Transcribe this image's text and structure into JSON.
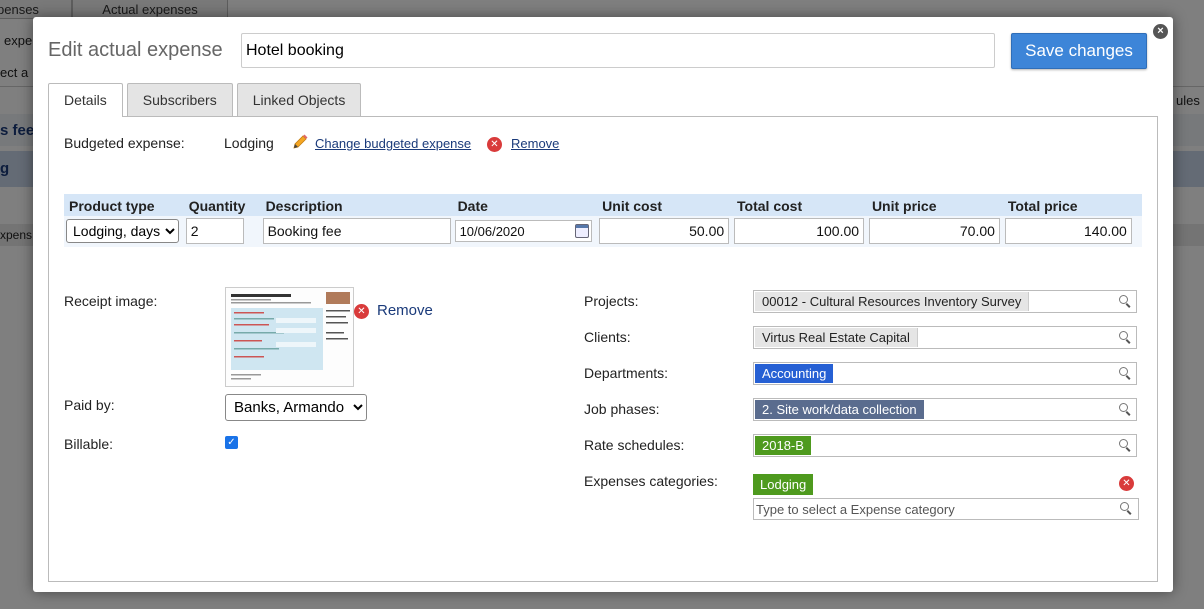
{
  "background": {
    "tabs": [
      "penses",
      "Actual expenses"
    ],
    "fragments": [
      "expe",
      "ect a",
      "ules",
      "s fee",
      "g",
      "xpens"
    ]
  },
  "modal": {
    "title": "Edit actual expense",
    "name_value": "Hotel booking",
    "save_label": "Save changes",
    "close_label": "×"
  },
  "tabs": [
    "Details",
    "Subscribers",
    "Linked Objects"
  ],
  "budgeted": {
    "label": "Budgeted expense:",
    "value": "Lodging",
    "change_link": "Change budgeted expense",
    "remove_link": "Remove"
  },
  "table": {
    "headers": [
      "Product type",
      "Quantity",
      "Description",
      "Date",
      "Unit cost",
      "Total cost",
      "Unit price",
      "Total price"
    ],
    "row": {
      "product_type": "Lodging, days",
      "quantity": "2",
      "description": "Booking fee",
      "date": "10/06/2020",
      "unit_cost": "50.00",
      "total_cost": "100.00",
      "unit_price": "70.00",
      "total_price": "140.00"
    }
  },
  "receipt": {
    "label": "Receipt image:",
    "remove_label": "Remove"
  },
  "paid_by": {
    "label": "Paid by:",
    "value": "Banks, Armando"
  },
  "billable": {
    "label": "Billable:",
    "checked": true
  },
  "fields": {
    "projects": {
      "label": "Projects:",
      "value": "00012 - Cultural Resources Inventory Survey"
    },
    "clients": {
      "label": "Clients:",
      "value": "Virtus Real Estate Capital"
    },
    "departments": {
      "label": "Departments:",
      "value": "Accounting"
    },
    "job_phases": {
      "label": "Job phases:",
      "value": "2. Site work/data collection"
    },
    "rate_schedules": {
      "label": "Rate schedules:",
      "value": "2018-B"
    },
    "expense_categories": {
      "label": "Expenses categories:",
      "value": "Lodging",
      "placeholder": "Type to select a Expense category"
    }
  },
  "colors": {
    "save_button": "#3d85d8",
    "chip_blue": "#2660d4",
    "chip_slate": "#5a6c8e",
    "chip_green": "#4e9a1e",
    "table_header": "#d6e6f7",
    "remove_icon": "#d93b3b"
  },
  "icons": {
    "close": "close-icon",
    "edit": "pencil-icon",
    "remove": "remove-icon",
    "calendar": "calendar-icon",
    "search": "search-icon"
  }
}
